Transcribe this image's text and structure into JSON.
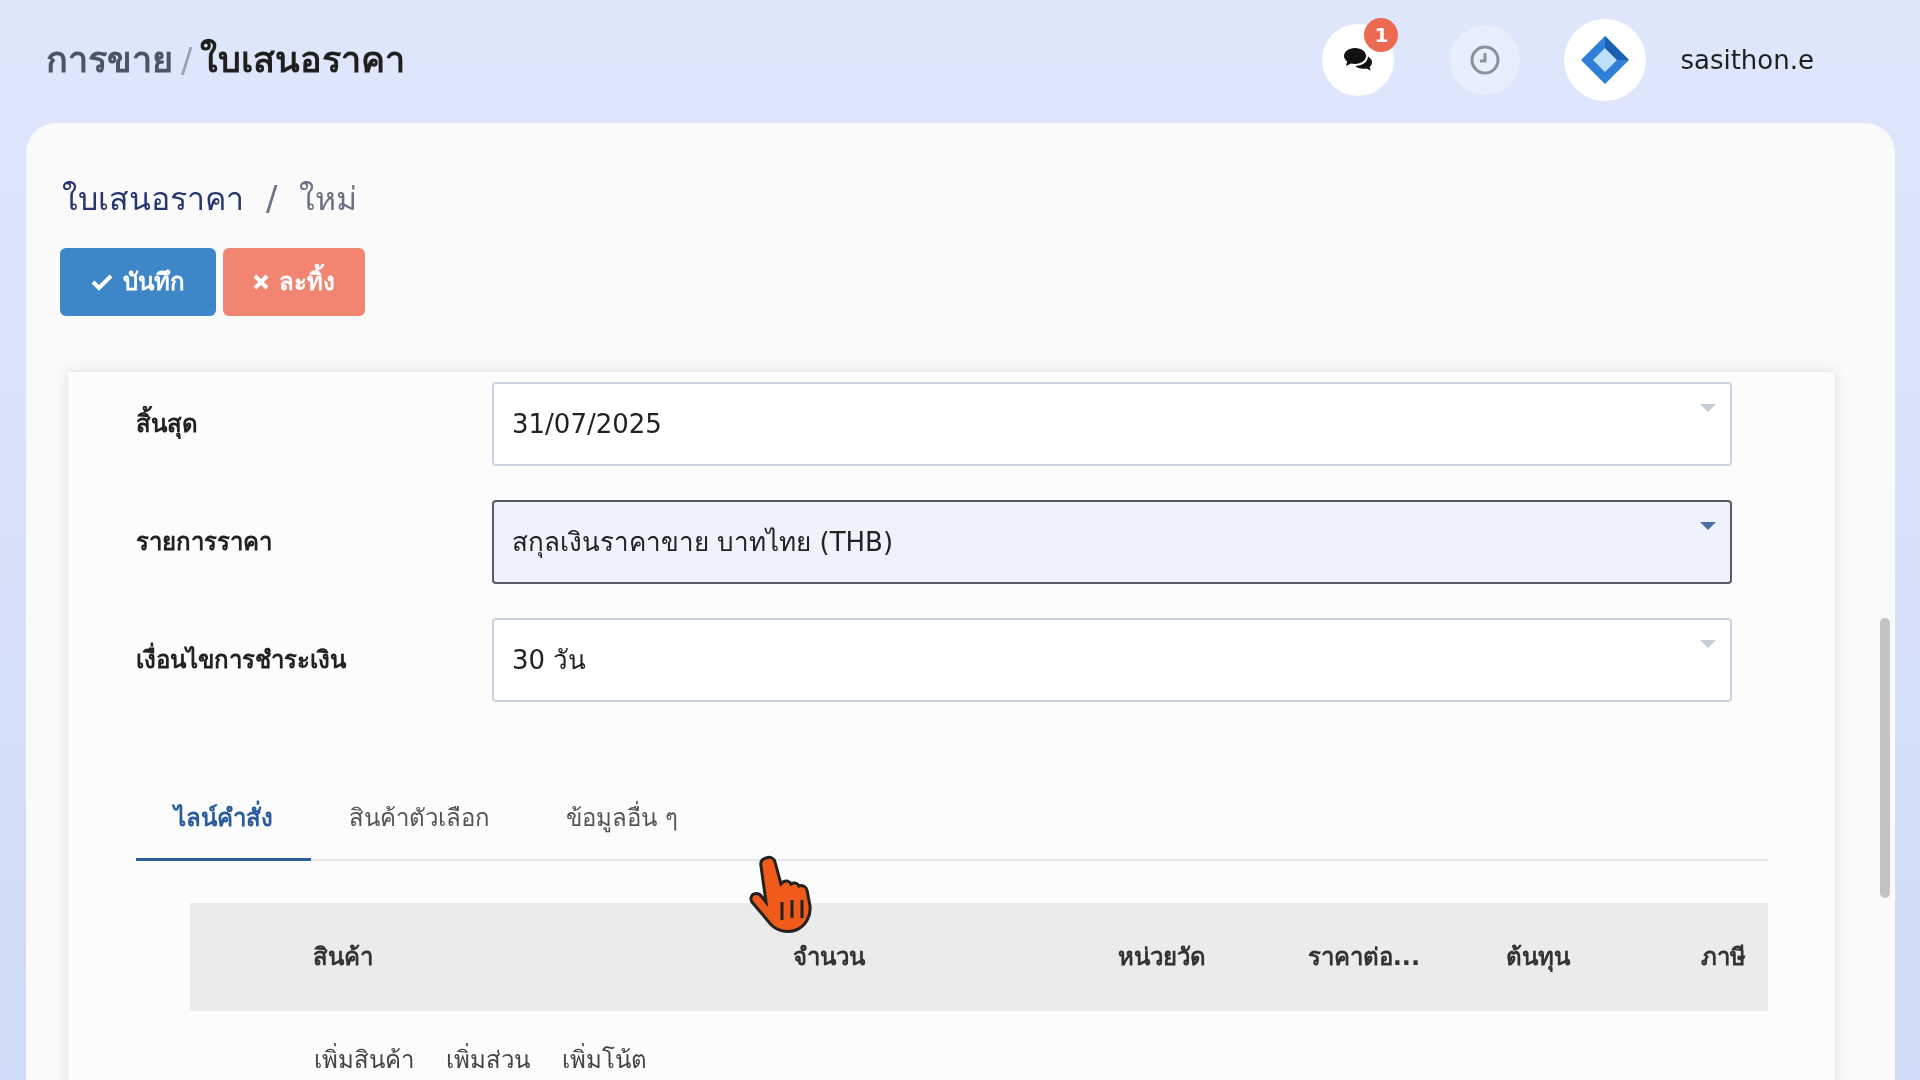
{
  "header": {
    "breadcrumb": [
      {
        "label": "การขาย",
        "current": false
      },
      {
        "label": "ใบเสนอราคา",
        "current": true
      }
    ],
    "separator": "/",
    "notification_count": "1",
    "username": "sasithon.e"
  },
  "page": {
    "breadcrumb": [
      {
        "label": "ใบเสนอราคา",
        "current": false
      },
      {
        "label": "ใหม่",
        "current": true
      }
    ],
    "separator": "/",
    "buttons": [
      {
        "kind": "save",
        "label": "บันทึก"
      },
      {
        "kind": "discard",
        "label": "ละทิ้ง"
      }
    ]
  },
  "fields": [
    {
      "label": "สิ้นสุด",
      "value": "31/07/2025",
      "focused": false
    },
    {
      "label": "รายการราคา",
      "value": "สกุลเงินราคาขาย บาทไทย (THB)",
      "focused": true
    },
    {
      "label": "เงื่อนไขการชำระเงิน",
      "value": "30 วัน",
      "focused": false
    }
  ],
  "tabs": [
    {
      "label": "ไลน์คำสั่ง",
      "selected": true
    },
    {
      "label": "สินค้าตัวเลือก",
      "selected": false
    },
    {
      "label": "ข้อมูลอื่น ๆ",
      "selected": false
    }
  ],
  "table": {
    "columns": [
      {
        "label": "สินค้า"
      },
      {
        "label": "จำนวน"
      },
      {
        "label": "หน่วยวัด"
      },
      {
        "label": "ราคาต่อ..."
      },
      {
        "label": "ต้นทุน"
      },
      {
        "label": "ภาษี"
      }
    ]
  },
  "add_links": [
    "เพิ่มสินค้า",
    "เพิ่มส่วน",
    "เพิ่มโน้ต"
  ]
}
